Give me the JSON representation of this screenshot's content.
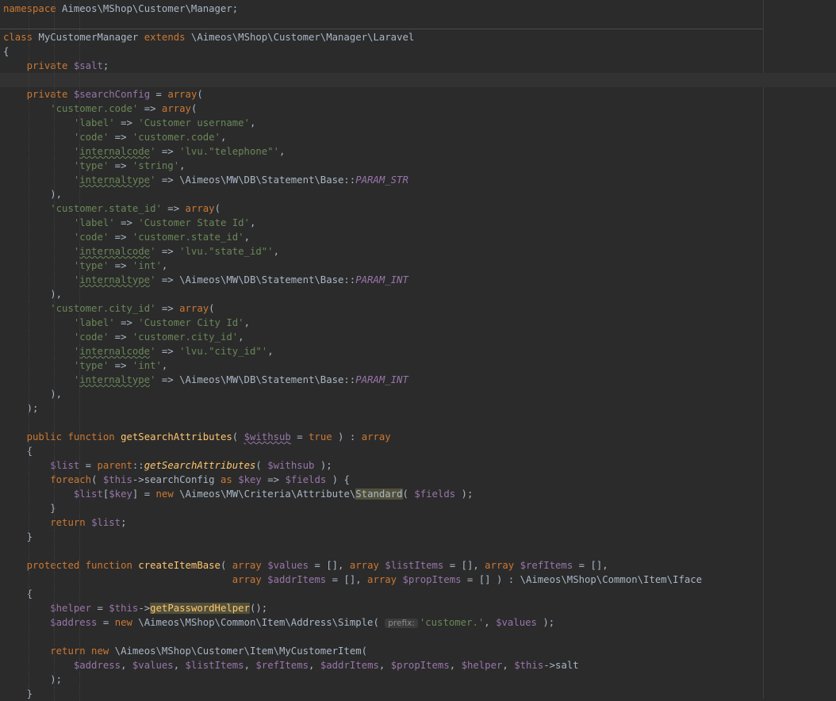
{
  "colors": {
    "background": "#2b2b2b",
    "keyword": "#cc7832",
    "variable": "#9876aa",
    "string": "#6a8759",
    "function": "#ffc66d",
    "text": "#a9b7c6"
  },
  "editor": {
    "lines": [
      [
        [
          "kw",
          "namespace"
        ],
        [
          "t",
          " "
        ],
        [
          "ns",
          "Aimeos\\MShop\\Customer\\Manager"
        ],
        [
          "t",
          ";"
        ]
      ],
      [],
      [
        [
          "kw",
          "class"
        ],
        [
          "t",
          " "
        ],
        [
          "t",
          "MyCustomerManager"
        ],
        [
          "t",
          " "
        ],
        [
          "kw",
          "extends"
        ],
        [
          "t",
          " \\Aimeos\\MShop\\Customer\\Manager\\"
        ],
        [
          "t",
          "Laravel"
        ]
      ],
      [
        [
          "t",
          "{"
        ]
      ],
      [
        [
          "t",
          "    "
        ],
        [
          "kw",
          "private"
        ],
        [
          "t",
          " "
        ],
        [
          "var",
          "$salt"
        ],
        [
          "t",
          ";"
        ]
      ],
      [],
      [
        [
          "t",
          "    "
        ],
        [
          "kw",
          "private"
        ],
        [
          "t",
          " "
        ],
        [
          "var",
          "$searchConfig"
        ],
        [
          "t",
          " = "
        ],
        [
          "kw",
          "array"
        ],
        [
          "t",
          "("
        ]
      ],
      [
        [
          "t",
          "        "
        ],
        [
          "str",
          "'customer.code'"
        ],
        [
          "t",
          " => "
        ],
        [
          "kw",
          "array"
        ],
        [
          "t",
          "("
        ]
      ],
      [
        [
          "t",
          "            "
        ],
        [
          "str",
          "'label'"
        ],
        [
          "t",
          " => "
        ],
        [
          "str",
          "'Customer username'"
        ],
        [
          "t",
          ","
        ]
      ],
      [
        [
          "t",
          "            "
        ],
        [
          "str",
          "'code'"
        ],
        [
          "t",
          " => "
        ],
        [
          "str",
          "'customer.code'"
        ],
        [
          "t",
          ","
        ]
      ],
      [
        [
          "t",
          "            "
        ],
        [
          "str",
          "'"
        ],
        [
          "strw",
          "internalcode"
        ],
        [
          "str",
          "'"
        ],
        [
          "t",
          " => "
        ],
        [
          "str",
          "'lvu.\"telephone\"'"
        ],
        [
          "t",
          ","
        ]
      ],
      [
        [
          "t",
          "            "
        ],
        [
          "str",
          "'type'"
        ],
        [
          "t",
          " => "
        ],
        [
          "str",
          "'string'"
        ],
        [
          "t",
          ","
        ]
      ],
      [
        [
          "t",
          "            "
        ],
        [
          "str",
          "'"
        ],
        [
          "strw",
          "internaltype"
        ],
        [
          "str",
          "'"
        ],
        [
          "t",
          " => \\Aimeos\\MW\\DB\\Statement\\Base::"
        ],
        [
          "const",
          "PARAM_STR"
        ]
      ],
      [
        [
          "t",
          "        ),"
        ]
      ],
      [
        [
          "t",
          "        "
        ],
        [
          "str",
          "'customer.state_id'"
        ],
        [
          "t",
          " => "
        ],
        [
          "kw",
          "array"
        ],
        [
          "t",
          "("
        ]
      ],
      [
        [
          "t",
          "            "
        ],
        [
          "str",
          "'label'"
        ],
        [
          "t",
          " => "
        ],
        [
          "str",
          "'Customer State Id'"
        ],
        [
          "t",
          ","
        ]
      ],
      [
        [
          "t",
          "            "
        ],
        [
          "str",
          "'code'"
        ],
        [
          "t",
          " => "
        ],
        [
          "str",
          "'customer.state_id'"
        ],
        [
          "t",
          ","
        ]
      ],
      [
        [
          "t",
          "            "
        ],
        [
          "str",
          "'"
        ],
        [
          "strw",
          "internalcode"
        ],
        [
          "str",
          "'"
        ],
        [
          "t",
          " => "
        ],
        [
          "str",
          "'lvu.\"state_id\"'"
        ],
        [
          "t",
          ","
        ]
      ],
      [
        [
          "t",
          "            "
        ],
        [
          "str",
          "'type'"
        ],
        [
          "t",
          " => "
        ],
        [
          "str",
          "'int'"
        ],
        [
          "t",
          ","
        ]
      ],
      [
        [
          "t",
          "            "
        ],
        [
          "str",
          "'"
        ],
        [
          "strw",
          "internaltype"
        ],
        [
          "str",
          "'"
        ],
        [
          "t",
          " => \\Aimeos\\MW\\DB\\Statement\\Base::"
        ],
        [
          "const",
          "PARAM_INT"
        ]
      ],
      [
        [
          "t",
          "        ),"
        ]
      ],
      [
        [
          "t",
          "        "
        ],
        [
          "str",
          "'customer.city_id'"
        ],
        [
          "t",
          " => "
        ],
        [
          "kw",
          "array"
        ],
        [
          "t",
          "("
        ]
      ],
      [
        [
          "t",
          "            "
        ],
        [
          "str",
          "'label'"
        ],
        [
          "t",
          " => "
        ],
        [
          "str",
          "'Customer City Id'"
        ],
        [
          "t",
          ","
        ]
      ],
      [
        [
          "t",
          "            "
        ],
        [
          "str",
          "'code'"
        ],
        [
          "t",
          " => "
        ],
        [
          "str",
          "'customer.city_id'"
        ],
        [
          "t",
          ","
        ]
      ],
      [
        [
          "t",
          "            "
        ],
        [
          "str",
          "'"
        ],
        [
          "strw",
          "internalcode"
        ],
        [
          "str",
          "'"
        ],
        [
          "t",
          " => "
        ],
        [
          "str",
          "'lvu.\"city_id\"'"
        ],
        [
          "t",
          ","
        ]
      ],
      [
        [
          "t",
          "            "
        ],
        [
          "str",
          "'type'"
        ],
        [
          "t",
          " => "
        ],
        [
          "str",
          "'int'"
        ],
        [
          "t",
          ","
        ]
      ],
      [
        [
          "t",
          "            "
        ],
        [
          "str",
          "'"
        ],
        [
          "strw",
          "internaltype"
        ],
        [
          "str",
          "'"
        ],
        [
          "t",
          " => \\Aimeos\\MW\\DB\\Statement\\Base::"
        ],
        [
          "const",
          "PARAM_INT"
        ]
      ],
      [
        [
          "t",
          "        ),"
        ]
      ],
      [
        [
          "t",
          "    );"
        ]
      ],
      [],
      [
        [
          "t",
          "    "
        ],
        [
          "kw",
          "public function"
        ],
        [
          "t",
          " "
        ],
        [
          "fn",
          "getSearchAttributes"
        ],
        [
          "t",
          "( "
        ],
        [
          "varw",
          "$withsub"
        ],
        [
          "t",
          " = "
        ],
        [
          "kw",
          "true"
        ],
        [
          "t",
          " ) : "
        ],
        [
          "kw",
          "array"
        ]
      ],
      [
        [
          "t",
          "    {"
        ]
      ],
      [
        [
          "t",
          "        "
        ],
        [
          "var",
          "$list"
        ],
        [
          "t",
          " = "
        ],
        [
          "kw",
          "parent"
        ],
        [
          "t",
          "::"
        ],
        [
          "sfn",
          "getSearchAttributes"
        ],
        [
          "t",
          "( "
        ],
        [
          "var",
          "$withsub"
        ],
        [
          "t",
          " );"
        ]
      ],
      [
        [
          "t",
          "        "
        ],
        [
          "kw",
          "foreach"
        ],
        [
          "t",
          "( "
        ],
        [
          "var",
          "$this"
        ],
        [
          "t",
          "->"
        ],
        [
          "t",
          "searchConfig"
        ],
        [
          "t",
          " "
        ],
        [
          "kw",
          "as"
        ],
        [
          "t",
          " "
        ],
        [
          "var",
          "$key"
        ],
        [
          "t",
          " => "
        ],
        [
          "var",
          "$fields"
        ],
        [
          "t",
          " ) {"
        ]
      ],
      [
        [
          "t",
          "            "
        ],
        [
          "var",
          "$list"
        ],
        [
          "t",
          "["
        ],
        [
          "var",
          "$key"
        ],
        [
          "t",
          "] = "
        ],
        [
          "kw",
          "new"
        ],
        [
          "t",
          " \\Aimeos\\MW\\Criteria\\Attribute\\"
        ],
        [
          "hl",
          "Standard"
        ],
        [
          "t",
          "( "
        ],
        [
          "var",
          "$fields"
        ],
        [
          "t",
          " );"
        ]
      ],
      [
        [
          "t",
          "        }"
        ]
      ],
      [
        [
          "t",
          "        "
        ],
        [
          "kw",
          "return"
        ],
        [
          "t",
          " "
        ],
        [
          "var",
          "$list"
        ],
        [
          "t",
          ";"
        ]
      ],
      [
        [
          "t",
          "    }"
        ]
      ],
      [],
      [
        [
          "t",
          "    "
        ],
        [
          "kw",
          "protected function"
        ],
        [
          "t",
          " "
        ],
        [
          "fn",
          "createItemBase"
        ],
        [
          "t",
          "( "
        ],
        [
          "kw",
          "array"
        ],
        [
          "t",
          " "
        ],
        [
          "var",
          "$values"
        ],
        [
          "t",
          " = [], "
        ],
        [
          "kw",
          "array"
        ],
        [
          "t",
          " "
        ],
        [
          "var",
          "$listItems"
        ],
        [
          "t",
          " = [], "
        ],
        [
          "kw",
          "array"
        ],
        [
          "t",
          " "
        ],
        [
          "var",
          "$refItems"
        ],
        [
          "t",
          " = [],"
        ]
      ],
      [
        [
          "t",
          "                                       "
        ],
        [
          "kw",
          "array"
        ],
        [
          "t",
          " "
        ],
        [
          "var",
          "$addrItems"
        ],
        [
          "t",
          " = [], "
        ],
        [
          "kw",
          "array"
        ],
        [
          "t",
          " "
        ],
        [
          "var",
          "$propItems"
        ],
        [
          "t",
          " = [] ) : \\Aimeos\\MShop\\Common\\Item\\Iface"
        ]
      ],
      [
        [
          "t",
          "    {"
        ]
      ],
      [
        [
          "t",
          "        "
        ],
        [
          "var",
          "$helper"
        ],
        [
          "t",
          " = "
        ],
        [
          "var",
          "$this"
        ],
        [
          "t",
          "->"
        ],
        [
          "hlfn",
          "getPasswordHelper"
        ],
        [
          "t",
          "();"
        ]
      ],
      [
        [
          "t",
          "        "
        ],
        [
          "var",
          "$address"
        ],
        [
          "t",
          " = "
        ],
        [
          "kw",
          "new"
        ],
        [
          "t",
          " \\Aimeos\\MShop\\Common\\Item\\Address\\Simple( "
        ],
        [
          "hint",
          "prefix:"
        ],
        [
          "str",
          "'customer.'"
        ],
        [
          "t",
          ", "
        ],
        [
          "var",
          "$values"
        ],
        [
          "t",
          " );"
        ]
      ],
      [],
      [
        [
          "t",
          "        "
        ],
        [
          "kw",
          "return new"
        ],
        [
          "t",
          " \\Aimeos\\MShop\\Customer\\Item\\"
        ],
        [
          "t",
          "MyCustomerItem("
        ]
      ],
      [
        [
          "t",
          "            "
        ],
        [
          "var",
          "$address"
        ],
        [
          "t",
          ", "
        ],
        [
          "var",
          "$values"
        ],
        [
          "t",
          ", "
        ],
        [
          "var",
          "$listItems"
        ],
        [
          "t",
          ", "
        ],
        [
          "var",
          "$refItems"
        ],
        [
          "t",
          ", "
        ],
        [
          "var",
          "$addrItems"
        ],
        [
          "t",
          ", "
        ],
        [
          "var",
          "$propItems"
        ],
        [
          "t",
          ", "
        ],
        [
          "var",
          "$helper"
        ],
        [
          "t",
          ", "
        ],
        [
          "var",
          "$this"
        ],
        [
          "t",
          "->salt"
        ]
      ],
      [
        [
          "t",
          "        );"
        ]
      ],
      [
        [
          "t",
          "    }"
        ]
      ]
    ]
  }
}
